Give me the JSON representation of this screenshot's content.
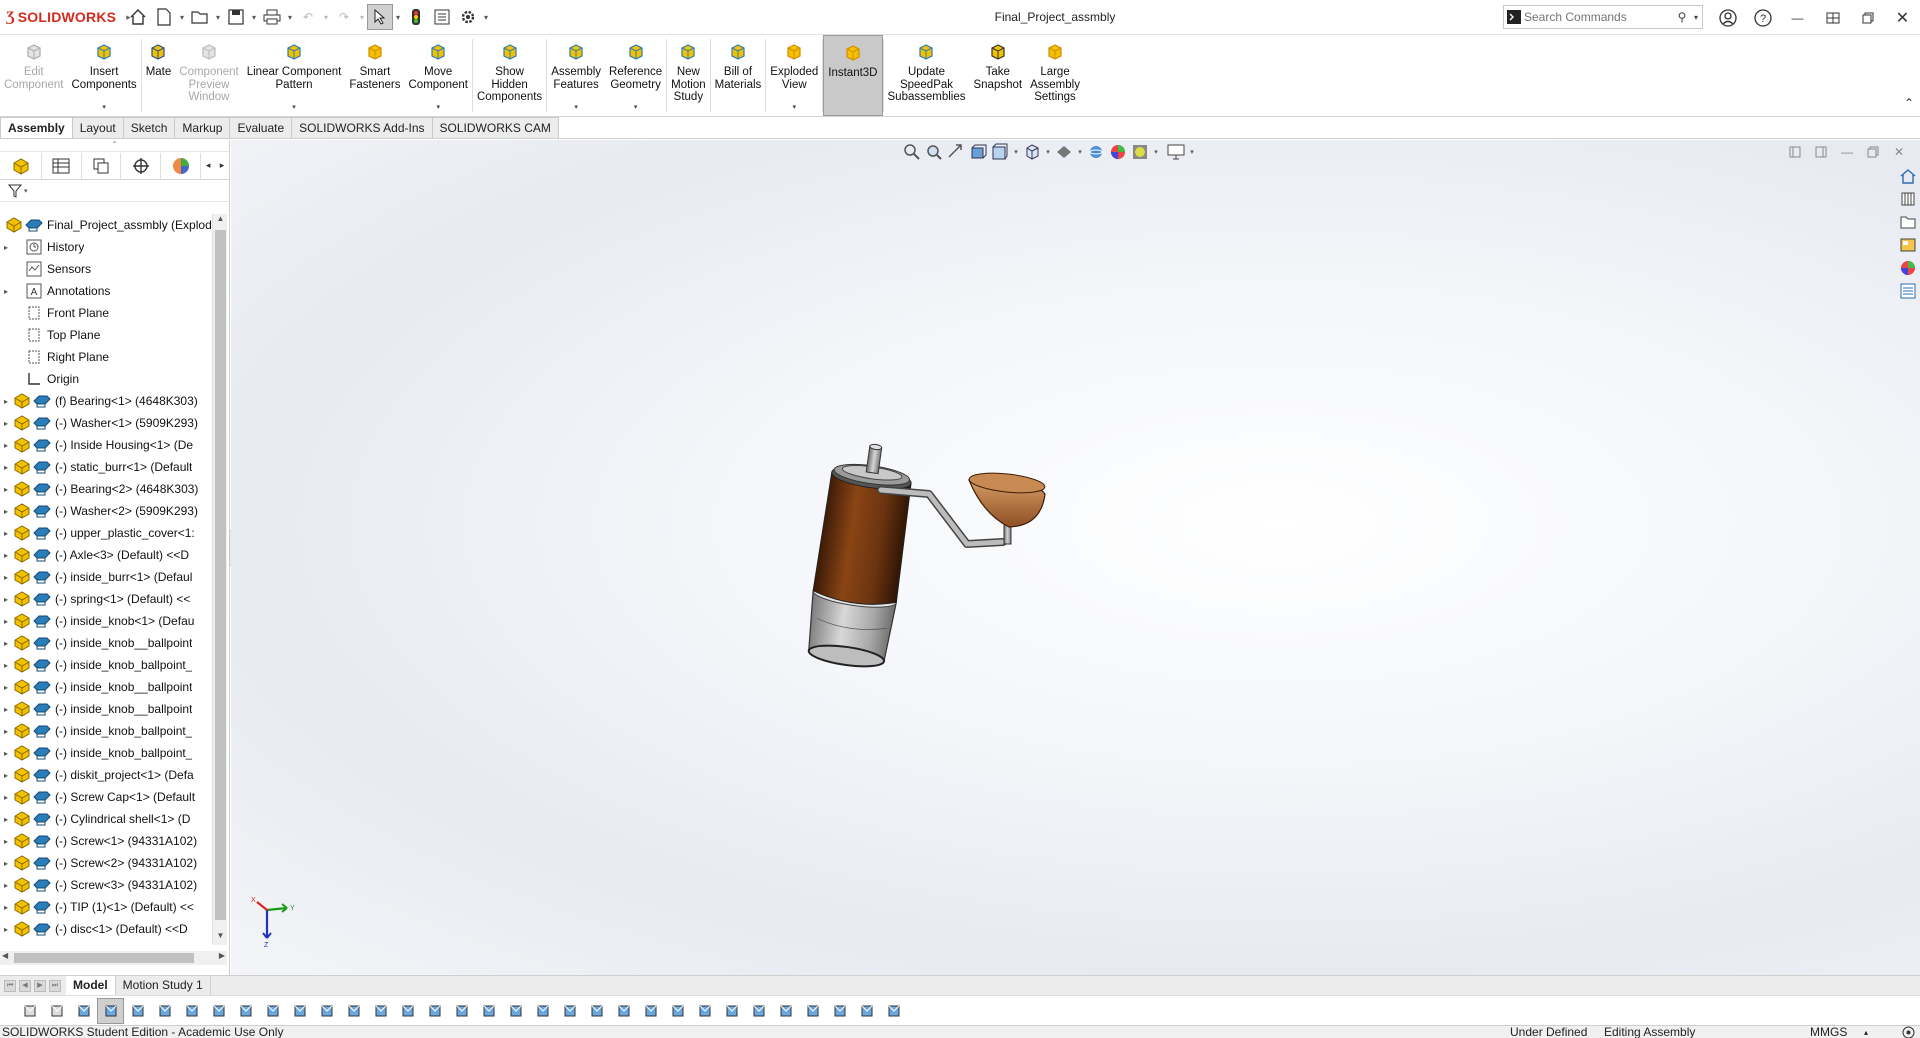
{
  "titlebar": {
    "brand_prefix": "3S",
    "brand": "SOLIDWORKS",
    "doc_title": "Final_Project_assmbly",
    "search_placeholder": "Search Commands",
    "icons": [
      "home-icon",
      "new-document-icon",
      "open-icon",
      "save-icon",
      "print-icon",
      "undo-icon",
      "redo-icon",
      "select-icon",
      "rebuild-icon",
      "file-properties-icon",
      "options-icon"
    ]
  },
  "ribbon": {
    "buttons": [
      {
        "label": "Edit\nComponent",
        "state": "disabled"
      },
      {
        "label": "Insert\nComponents",
        "state": "normal",
        "arrow": true
      },
      {
        "label": "Mate",
        "state": "normal"
      },
      {
        "label": "Component\nPreview\nWindow",
        "state": "disabled"
      },
      {
        "label": "Linear Component\nPattern",
        "state": "normal",
        "arrow": true
      },
      {
        "label": "Smart\nFasteners",
        "state": "normal"
      },
      {
        "label": "Move\nComponent",
        "state": "normal",
        "arrow": true
      },
      {
        "label": "Show\nHidden\nComponents",
        "state": "normal"
      },
      {
        "label": "Assembly\nFeatures",
        "state": "normal",
        "arrow": true
      },
      {
        "label": "Reference\nGeometry",
        "state": "normal",
        "arrow": true
      },
      {
        "label": "New\nMotion\nStudy",
        "state": "normal"
      },
      {
        "label": "Bill of\nMaterials",
        "state": "normal"
      },
      {
        "label": "Exploded\nView",
        "state": "normal",
        "arrow": true
      },
      {
        "label": "Instant3D",
        "state": "active"
      },
      {
        "label": "Update\nSpeedPak\nSubassemblies",
        "state": "normal"
      },
      {
        "label": "Take\nSnapshot",
        "state": "normal"
      },
      {
        "label": "Large\nAssembly\nSettings",
        "state": "normal"
      }
    ]
  },
  "tabs": [
    "Assembly",
    "Layout",
    "Sketch",
    "Markup",
    "Evaluate",
    "SOLIDWORKS Add-Ins",
    "SOLIDWORKS CAM"
  ],
  "tree": {
    "root": "Final_Project_assmbly (Exploded",
    "items": [
      {
        "label": "History",
        "kind": "history",
        "expandable": true
      },
      {
        "label": "Sensors",
        "kind": "sensors",
        "expandable": false
      },
      {
        "label": "Annotations",
        "kind": "annotations",
        "expandable": true
      },
      {
        "label": "Front Plane",
        "kind": "plane",
        "expandable": false
      },
      {
        "label": "Top Plane",
        "kind": "plane",
        "expandable": false
      },
      {
        "label": "Right Plane",
        "kind": "plane",
        "expandable": false
      },
      {
        "label": "Origin",
        "kind": "origin",
        "expandable": false
      },
      {
        "label": "(f) Bearing<1> (4648K303)",
        "kind": "part",
        "expandable": true
      },
      {
        "label": "(-) Washer<1> (5909K293)",
        "kind": "part",
        "expandable": true
      },
      {
        "label": "(-) Inside Housing<1> (De",
        "kind": "part",
        "expandable": true
      },
      {
        "label": "(-) static_burr<1> (Default",
        "kind": "part",
        "expandable": true
      },
      {
        "label": "(-) Bearing<2> (4648K303)",
        "kind": "part",
        "expandable": true
      },
      {
        "label": "(-) Washer<2> (5909K293)",
        "kind": "part",
        "expandable": true
      },
      {
        "label": "(-) upper_plastic_cover<1:",
        "kind": "part",
        "expandable": true
      },
      {
        "label": "(-) Axle<3> (Default) <<D",
        "kind": "part",
        "expandable": true
      },
      {
        "label": "(-) inside_burr<1> (Defaul",
        "kind": "part",
        "expandable": true
      },
      {
        "label": "(-) spring<1> (Default) <<",
        "kind": "part",
        "expandable": true
      },
      {
        "label": "(-) inside_knob<1> (Defau",
        "kind": "part",
        "expandable": true
      },
      {
        "label": "(-) inside_knob__ballpoint",
        "kind": "part",
        "expandable": true
      },
      {
        "label": "(-) inside_knob_ballpoint_",
        "kind": "part",
        "expandable": true
      },
      {
        "label": "(-) inside_knob__ballpoint",
        "kind": "part",
        "expandable": true
      },
      {
        "label": "(-) inside_knob__ballpoint",
        "kind": "part",
        "expandable": true
      },
      {
        "label": "(-) inside_knob_ballpoint_",
        "kind": "part",
        "expandable": true
      },
      {
        "label": "(-) inside_knob_ballpoint_",
        "kind": "part",
        "expandable": true
      },
      {
        "label": "(-) diskit_project<1> (Defa",
        "kind": "part",
        "expandable": true
      },
      {
        "label": "(-) Screw Cap<1> (Default",
        "kind": "part",
        "expandable": true
      },
      {
        "label": "(-) Cylindrical shell<1> (D",
        "kind": "part",
        "expandable": true
      },
      {
        "label": "(-) Screw<1> (94331A102)",
        "kind": "part",
        "expandable": true
      },
      {
        "label": "(-) Screw<2> (94331A102)",
        "kind": "part",
        "expandable": true
      },
      {
        "label": "(-) Screw<3> (94331A102)",
        "kind": "part",
        "expandable": true
      },
      {
        "label": "(-) TIP (1)<1> (Default) <<",
        "kind": "part",
        "expandable": true
      },
      {
        "label": "(-) disc<1> (Default) <<D",
        "kind": "part",
        "expandable": true
      }
    ]
  },
  "bottom_tabs": [
    "Model",
    "Motion Study 1"
  ],
  "status": {
    "edition": "SOLIDWORKS Student Edition - Academic Use Only",
    "definition": "Under Defined",
    "mode": "Editing Assembly",
    "units": "MMGS"
  },
  "colors": {
    "brand_red": "#d52b1e",
    "part_yellow": "#f2c200",
    "assembly_blue": "#2a7db8",
    "grinder_brown": "#7a3a10",
    "funnel_brown": "#b8743e"
  }
}
